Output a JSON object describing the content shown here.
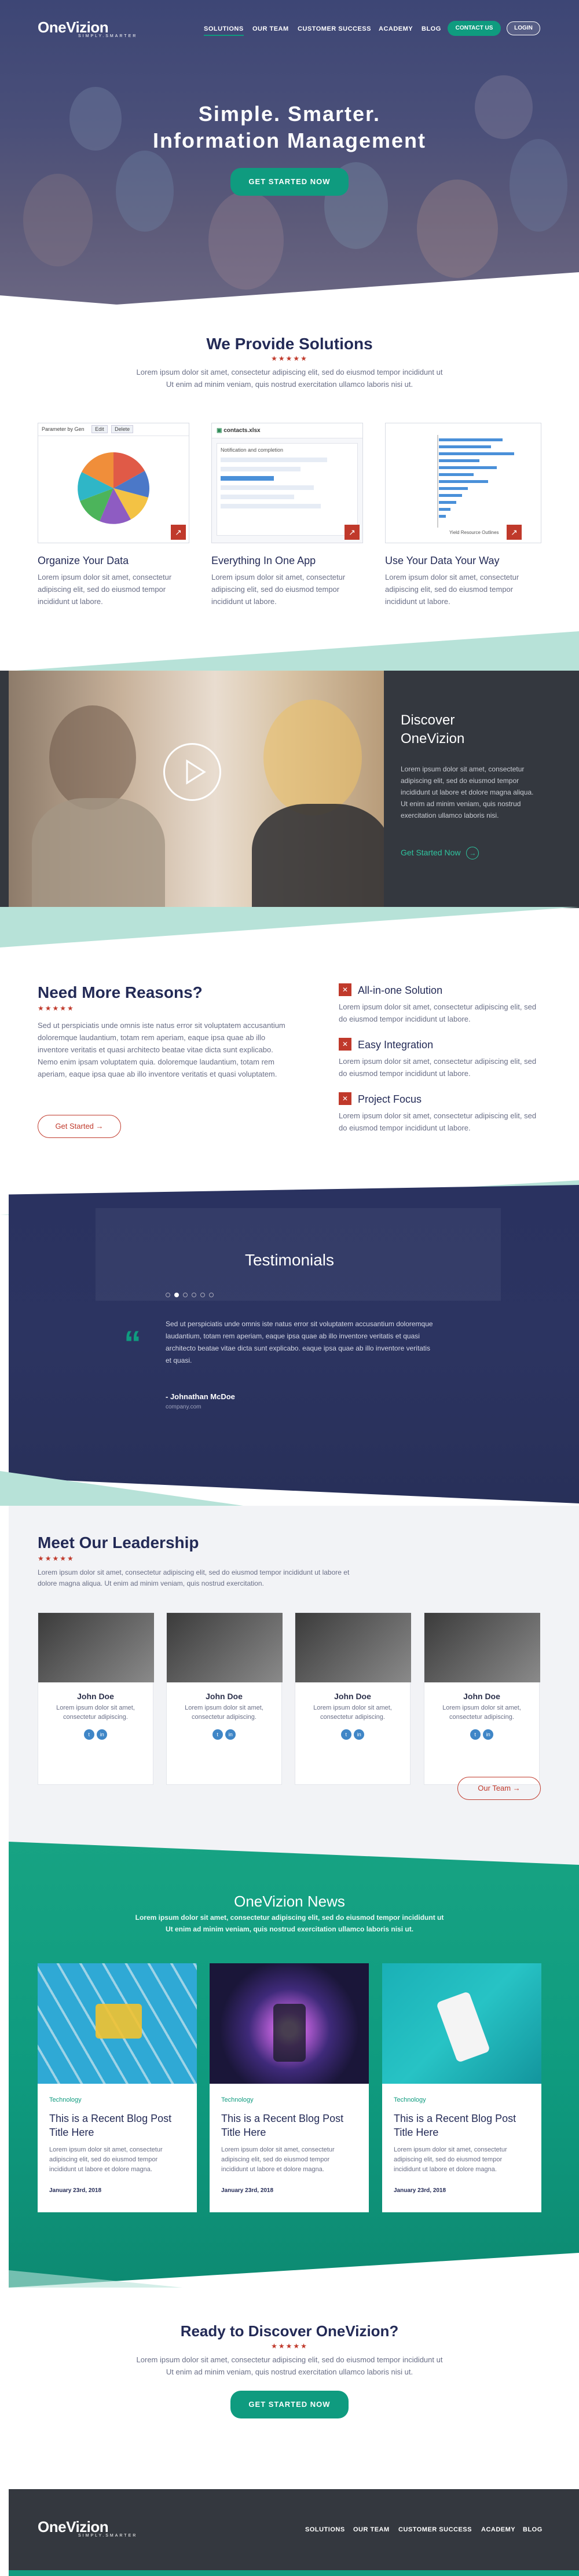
{
  "nav": {
    "logo": "OneVizion",
    "logo_sub": "SIMPLY.SMARTER",
    "links": [
      "SOLUTIONS",
      "OUR TEAM",
      "CUSTOMER SUCCESS",
      "ACADEMY",
      "BLOG"
    ],
    "contact_label": "CONTACT US",
    "login_label": "LOGIN"
  },
  "hero": {
    "title_line1": "Simple. Smarter.",
    "title_line2": "Information Management",
    "cta_label": "GET STARTED NOW"
  },
  "solutions": {
    "title": "We Provide Solutions",
    "intro_line1": "Lorem ipsum dolor sit amet, consectetur adipiscing elit, sed do eiusmod tempor incididunt ut",
    "intro_line2": "Ut enim ad minim veniam, quis nostrud exercitation ullamco laboris nisi ut.",
    "cards": [
      {
        "title": "Organize Your Data",
        "text": "Lorem ipsum dolor sit amet, consectetur adipiscing elit, sed do eiusmod tempor incididunt ut labore.",
        "shot_label": "Parameter by Gen",
        "shot_btn1": "Edit",
        "shot_btn2": "Delete"
      },
      {
        "title": "Everything In One App",
        "text": "Lorem ipsum dolor sit amet, consectetur adipiscing elit, sed do eiusmod tempor incididunt ut labore.",
        "shot_label": "contacts.xlsx",
        "shot_sub": "Notification and completion"
      },
      {
        "title": "Use Your Data Your Way",
        "text": "Lorem ipsum dolor sit amet, consectetur adipiscing elit, sed do eiusmod tempor incididunt ut labore.",
        "shot_label": "Yield Resource Outlines"
      }
    ]
  },
  "discover": {
    "title_line1": "Discover",
    "title_line2": "OneVizion",
    "text": "Lorem ipsum dolor sit amet, consectetur adipiscing elit, sed do eiusmod tempor incididunt ut labore et dolore magna aliqua. Ut enim ad minim veniam, quis nostrud exercitation ullamco laboris nisi.",
    "link_label": "Get Started Now"
  },
  "reasons": {
    "title": "Need More Reasons?",
    "text": "Sed ut perspiciatis unde omnis iste natus error sit voluptatem accusantium doloremque laudantium, totam rem aperiam, eaque ipsa quae ab illo inventore veritatis et quasi architecto beatae vitae dicta sunt explicabo. Nemo enim ipsam voluptatem quia. doloremque laudantium, totam rem aperiam, eaque ipsa quae ab illo inventore veritatis et quasi voluptatem.",
    "cta_label": "Get Started",
    "items": [
      {
        "title": "All-in-one Solution",
        "text": "Lorem ipsum dolor sit amet, consectetur adipiscing elit, sed do eiusmod tempor incididunt ut labore."
      },
      {
        "title": "Easy Integration",
        "text": "Lorem ipsum dolor sit amet, consectetur adipiscing elit, sed do eiusmod tempor incididunt ut labore."
      },
      {
        "title": "Project Focus",
        "text": "Lorem ipsum dolor sit amet, consectetur adipiscing elit, sed do eiusmod tempor incididunt ut labore."
      }
    ]
  },
  "testimonials": {
    "title": "Testimonials",
    "quote": "Sed ut perspiciatis unde omnis iste natus error sit voluptatem accusantium doloremque laudantium, totam rem aperiam, eaque ipsa quae ab illo inventore veritatis et quasi architecto beatae vitae dicta sunt explicabo. eaque ipsa quae ab illo inventore veritatis et quasi.",
    "author": "- Johnathan McDoe",
    "company": "company.com",
    "active_dot": 2,
    "dot_count": 6
  },
  "leadership": {
    "title": "Meet Our Leadership",
    "intro": "Lorem ipsum dolor sit amet, consectetur adipiscing elit, sed do eiusmod tempor incididunt ut labore et dolore magna aliqua. Ut enim ad minim veniam, quis nostrud exercitation.",
    "members": [
      {
        "name": "John Doe",
        "text": "Lorem ipsum dolor sit amet, consectetur adipiscing."
      },
      {
        "name": "John Doe",
        "text": "Lorem ipsum dolor sit amet, consectetur adipiscing."
      },
      {
        "name": "John Doe",
        "text": "Lorem ipsum dolor sit amet, consectetur adipiscing."
      },
      {
        "name": "John Doe",
        "text": "Lorem ipsum dolor sit amet, consectetur adipiscing."
      }
    ],
    "cta_label": "Our Team"
  },
  "news": {
    "title": "OneVizion News",
    "intro_line1": "Lorem ipsum dolor sit amet, consectetur adipiscing elit, sed do eiusmod tempor incididunt ut",
    "intro_line2": "Ut enim ad minim veniam, quis nostrud exercitation ullamco laboris nisi ut.",
    "posts": [
      {
        "tag": "Technology",
        "title": "This is a Recent Blog Post Title Here",
        "text": "Lorem ipsum dolor sit amet, consectetur adipiscing elit, sed do eiusmod tempor incididunt ut labore et dolore magna.",
        "date": "January 23rd, 2018"
      },
      {
        "tag": "Technology",
        "title": "This is a Recent Blog Post Title Here",
        "text": "Lorem ipsum dolor sit amet, consectetur adipiscing elit, sed do eiusmod tempor incididunt ut labore et dolore magna.",
        "date": "January 23rd, 2018"
      },
      {
        "tag": "Technology",
        "title": "This is a Recent Blog Post Title Here",
        "text": "Lorem ipsum dolor sit amet, consectetur adipiscing elit, sed do eiusmod tempor incididunt ut labore et dolore magna.",
        "date": "January 23rd, 2018"
      }
    ]
  },
  "cta": {
    "title": "Ready to Discover OneVizion?",
    "intro_line1": "Lorem ipsum dolor sit amet, consectetur adipiscing elit, sed do eiusmod tempor incididunt ut",
    "intro_line2": "Ut enim ad minim veniam, quis nostrud exercitation ullamco laboris nisi ut.",
    "button_label": "GET STARTED NOW"
  },
  "footer": {
    "logo": "OneVizion",
    "logo_sub": "SIMPLY.SMARTER",
    "links": [
      "SOLUTIONS",
      "OUR TEAM",
      "CUSTOMER SUCCESS",
      "ACADEMY",
      "BLOG"
    ]
  },
  "colors": {
    "navy": "#232a56",
    "teal": "#0f9b7f",
    "red": "#c0392b",
    "dark": "#34383f"
  }
}
